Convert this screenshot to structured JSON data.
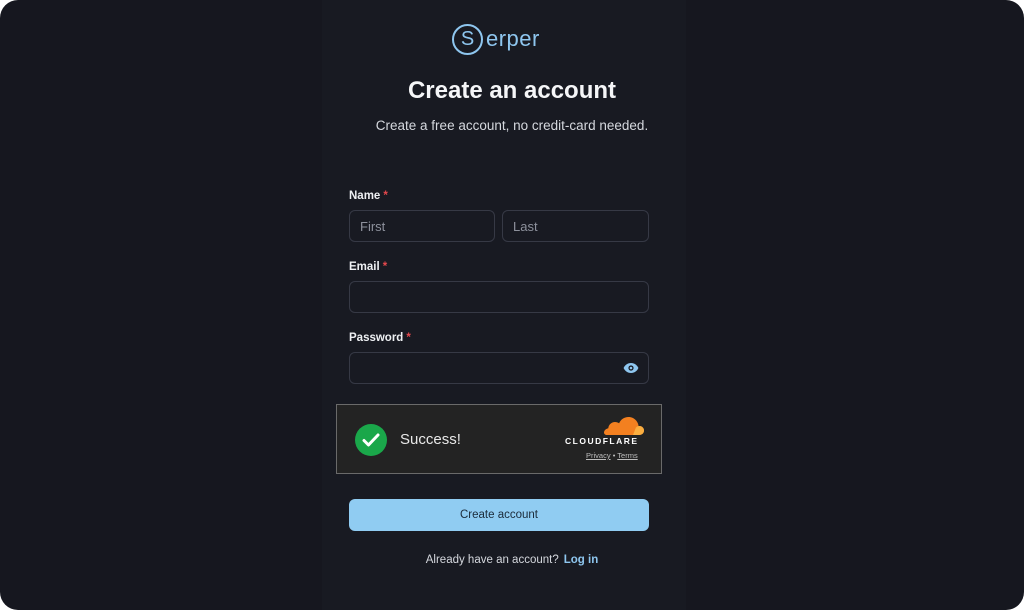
{
  "brand": {
    "logo_letter": "S",
    "logo_text": "erper",
    "color": "#8ec6ef"
  },
  "header": {
    "title": "Create an account",
    "subtitle": "Create a free account, no credit-card needed."
  },
  "form": {
    "name_label": "Name",
    "first_placeholder": "First",
    "last_placeholder": "Last",
    "email_label": "Email",
    "email_value": "",
    "password_label": "Password",
    "password_value": "",
    "required_marker": "*",
    "eye_icon": "eye-icon"
  },
  "captcha": {
    "status": "Success!",
    "provider": "CLOUDFLARE",
    "privacy_link": "Privacy",
    "separator": "•",
    "terms_link": "Terms",
    "success_color": "#1aa74a",
    "cloud_color": "#f38020"
  },
  "submit_label": "Create account",
  "footer": {
    "prompt": "Already have an account?",
    "login_link": "Log in"
  }
}
